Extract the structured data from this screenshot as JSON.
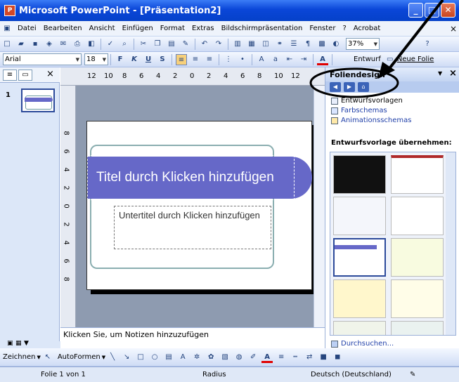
{
  "window": {
    "title": "Microsoft PowerPoint - [Präsentation2]",
    "app_icon": "P",
    "controls": {
      "minimize": "_",
      "maximize": "□",
      "close": "✕"
    }
  },
  "menubar": {
    "items": [
      "Datei",
      "Bearbeiten",
      "Ansicht",
      "Einfügen",
      "Format",
      "Extras",
      "Bildschirmpräsentation",
      "Fenster",
      "?",
      "Acrobat"
    ],
    "close_glyph": "×"
  },
  "toolbar_standard": {
    "zoom": "37%",
    "help_glyph": "?"
  },
  "toolbar_format": {
    "font": "Arial",
    "size": "18",
    "bold": "F",
    "italic": "K",
    "underline": "U",
    "shadow": "S",
    "font_color": "A",
    "entwurf_label": "Entwurf",
    "neue_folie_label": "Neue Folie"
  },
  "left_panel": {
    "slide_number": "1",
    "close_glyph": "×"
  },
  "ruler_h": {
    "ticks": [
      "12",
      "10",
      "8",
      "6",
      "4",
      "2",
      "0",
      "2",
      "4",
      "6",
      "8",
      "10",
      "12"
    ]
  },
  "ruler_v": {
    "ticks": [
      "8",
      "6",
      "4",
      "2",
      "0",
      "2",
      "4",
      "6",
      "8"
    ]
  },
  "slide": {
    "title_placeholder": "Titel durch Klicken hinzufügen",
    "subtitle_placeholder": "Untertitel durch Klicken hinzufügen",
    "accent_color": "#6668c8",
    "border_color": "#8aaeb0"
  },
  "notes": {
    "placeholder": "Klicken Sie, um Notizen hinzuzufügen"
  },
  "task_pane": {
    "title": "Foliendesign",
    "links": [
      "Entwurfsvorlagen",
      "Farbschemas",
      "Animationsschemas"
    ],
    "section_heading": "Entwurfsvorlage übernehmen:",
    "search_link": "Durchsuchen...",
    "close_glyph": "×",
    "dropdown_glyph": "▼"
  },
  "drawbar": {
    "zeichnen": "Zeichnen",
    "autoformen": "AutoFormen"
  },
  "statusbar": {
    "slide_info": "Folie 1 von 1",
    "design": "Radius",
    "language": "Deutsch (Deutschland)"
  },
  "colors": {
    "titlebar": "#0a46d8",
    "selection": "#2c4a9a",
    "annotation": "#000000"
  }
}
